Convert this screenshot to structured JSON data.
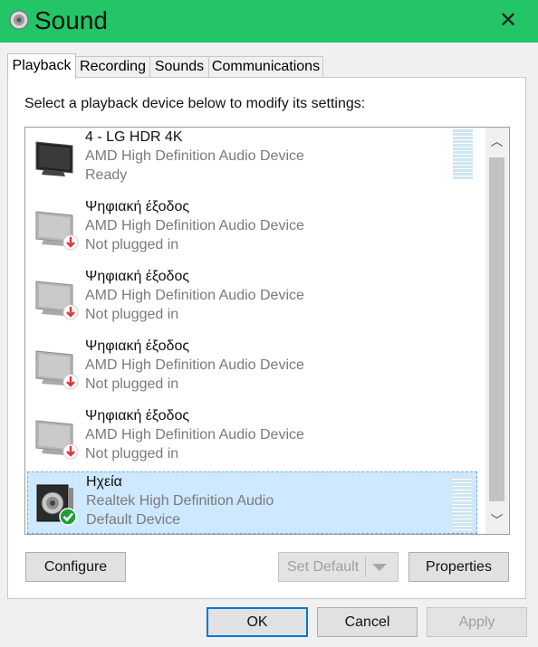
{
  "window": {
    "title": "Sound",
    "close_symbol": "✕"
  },
  "tabs": [
    {
      "label": "Playback",
      "active": true
    },
    {
      "label": "Recording",
      "active": false
    },
    {
      "label": "Sounds",
      "active": false
    },
    {
      "label": "Communications",
      "active": false
    }
  ],
  "instructions": "Select a playback device below to modify its settings:",
  "devices": [
    {
      "name": "4 - LG HDR 4K",
      "description": "AMD High Definition Audio Device",
      "status": "Ready",
      "icon": "monitor-icon",
      "badge": "none",
      "selected": false
    },
    {
      "name": "Ψηφιακή έξοδος",
      "description": "AMD High Definition Audio Device",
      "status": "Not plugged in",
      "icon": "monitor-icon",
      "badge": "red-down-arrow",
      "selected": false
    },
    {
      "name": "Ψηφιακή έξοδος",
      "description": "AMD High Definition Audio Device",
      "status": "Not plugged in",
      "icon": "monitor-icon",
      "badge": "red-down-arrow",
      "selected": false
    },
    {
      "name": "Ψηφιακή έξοδος",
      "description": "AMD High Definition Audio Device",
      "status": "Not plugged in",
      "icon": "monitor-icon",
      "badge": "red-down-arrow",
      "selected": false
    },
    {
      "name": "Ψηφιακή έξοδος",
      "description": "AMD High Definition Audio Device",
      "status": "Not plugged in",
      "icon": "monitor-icon",
      "badge": "red-down-arrow",
      "selected": false
    },
    {
      "name": "Ηχεία",
      "description": "Realtek High Definition Audio",
      "status": "Default Device",
      "icon": "speaker-icon",
      "badge": "green-check",
      "selected": true
    }
  ],
  "scrollbar": {
    "up": "︿",
    "down": "﹀"
  },
  "buttons": {
    "configure": "Configure",
    "set_default": "Set Default",
    "properties": "Properties",
    "ok": "OK",
    "cancel": "Cancel",
    "apply": "Apply"
  },
  "colors": {
    "titlebar": "#23c567",
    "selection": "#cde8ff",
    "primary_border": "#0078d7"
  }
}
